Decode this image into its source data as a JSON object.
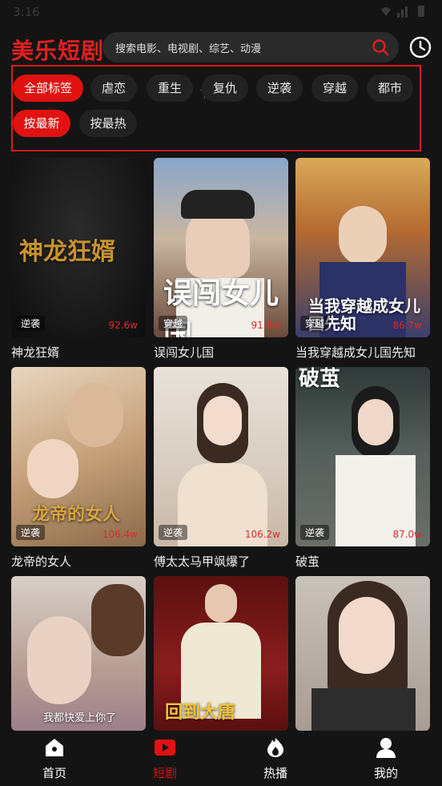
{
  "status": {
    "time": "3:16"
  },
  "header": {
    "logo": "美乐短剧",
    "search_placeholder": "搜索电影、电视剧、综艺、动漫"
  },
  "categories": [
    "全部标签",
    "虐恋",
    "重生",
    "复仇",
    "逆袭",
    "穿越",
    "都市"
  ],
  "sorts": [
    "按最新",
    "按最热"
  ],
  "faint_filter": "下拉",
  "dramas": [
    {
      "title": "神龙狂婿",
      "tag": "逆袭",
      "count": "92.6w",
      "poster_text": "神龙狂婿"
    },
    {
      "title": "误闯女儿国",
      "tag": "穿越",
      "count": "91.8w",
      "poster_text": "误闯女儿国"
    },
    {
      "title": "当我穿越成女儿国先知",
      "tag": "穿越",
      "count": "86.7w",
      "poster_text": "当我穿越成女儿国先知"
    },
    {
      "title": "龙帝的女人",
      "tag": "逆袭",
      "count": "106.4w",
      "poster_text": "龙帝的女人"
    },
    {
      "title": "傅太太马甲飒爆了",
      "tag": "逆袭",
      "count": "106.2w",
      "poster_text": ""
    },
    {
      "title": "破茧",
      "tag": "逆袭",
      "count": "87.0w",
      "poster_text": "破茧"
    },
    {
      "title": "",
      "tag": "",
      "count": "",
      "poster_text": "我都快爱上你了"
    },
    {
      "title": "",
      "tag": "",
      "count": "",
      "poster_text": "回到大唐"
    },
    {
      "title": "",
      "tag": "",
      "count": "",
      "poster_text": ""
    }
  ],
  "nav": [
    "首页",
    "短剧",
    "热播",
    "我的"
  ],
  "colors": {
    "accent": "#e01212",
    "background": "#141414"
  }
}
